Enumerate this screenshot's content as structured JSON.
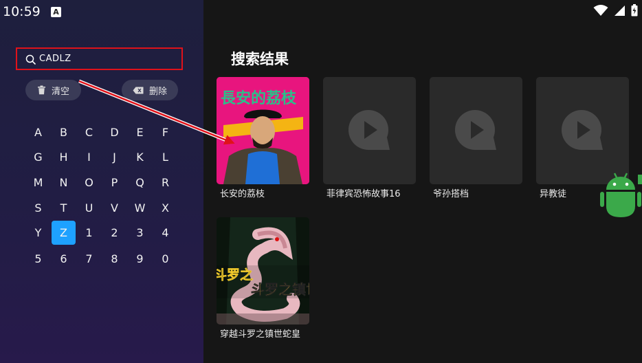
{
  "status_bar": {
    "time": "10:59",
    "notification_icon": "A"
  },
  "search": {
    "query": "CADLZ"
  },
  "actions": {
    "clear_label": "清空",
    "delete_label": "删除"
  },
  "keyboard": {
    "rows": [
      [
        "A",
        "B",
        "C",
        "D",
        "E",
        "F"
      ],
      [
        "G",
        "H",
        "I",
        "J",
        "K",
        "L"
      ],
      [
        "M",
        "N",
        "O",
        "P",
        "Q",
        "R"
      ],
      [
        "S",
        "T",
        "U",
        "V",
        "W",
        "X"
      ],
      [
        "Y",
        "Z",
        "1",
        "2",
        "3",
        "4"
      ],
      [
        "5",
        "6",
        "7",
        "8",
        "9",
        "0"
      ]
    ],
    "active_key": "Z"
  },
  "results": {
    "title": "搜索结果",
    "items": [
      {
        "title": "长安的荔枝",
        "poster_text": "長安的荔枝"
      },
      {
        "title": "菲律宾恐怖故事16"
      },
      {
        "title": "爷孙搭档"
      },
      {
        "title": "异教徒"
      },
      {
        "title": "穿越斗罗之镇世蛇皇",
        "poster_text": "斗罗之镇世蛇皇"
      }
    ]
  },
  "colors": {
    "accent": "#1ea1ff",
    "highlight_box": "#e0121a",
    "annotation_arrow": "#e0121a"
  }
}
